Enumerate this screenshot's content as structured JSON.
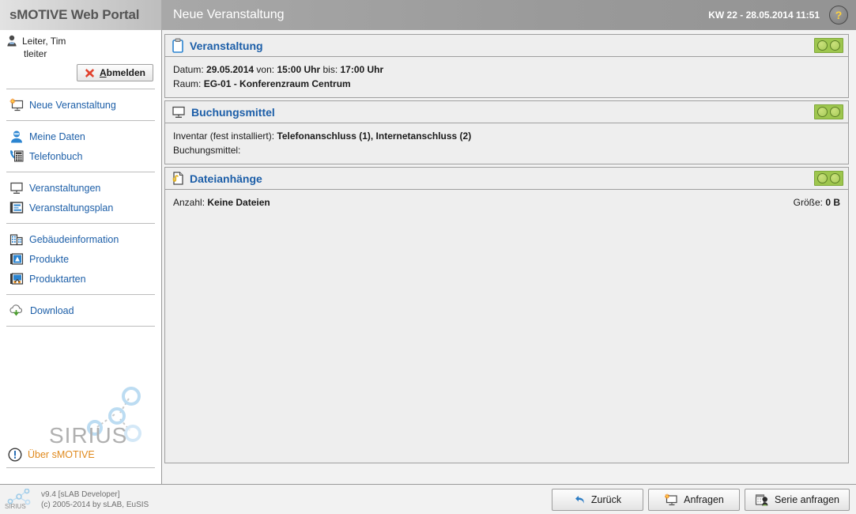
{
  "header": {
    "brand": "sMOTIVE Web Portal",
    "page_title": "Neue Veranstaltung",
    "kw_datetime": "KW 22 - 28.05.2014 11:51",
    "help_label": "?",
    "help_icon": "question-mark-icon"
  },
  "sidebar": {
    "user": {
      "name": "Leiter, Tim",
      "login": "tleiter",
      "avatar_icon": "user-icon",
      "logout_label": "Abmelden",
      "logout_label_first": "A",
      "logout_label_rest": "bmelden",
      "logout_icon": "red-x-icon"
    },
    "groups": [
      {
        "items": [
          {
            "label": "Neue Veranstaltung",
            "icon": "new-event-monitor-icon"
          }
        ]
      },
      {
        "items": [
          {
            "label": "Meine Daten",
            "icon": "person-card-icon"
          },
          {
            "label": "Telefonbuch",
            "icon": "phonebook-icon"
          }
        ]
      },
      {
        "items": [
          {
            "label": "Veranstaltungen",
            "icon": "monitor-icon"
          },
          {
            "label": "Veranstaltungsplan",
            "icon": "schedule-icon"
          }
        ]
      },
      {
        "items": [
          {
            "label": "Gebäudeinformation",
            "icon": "building-icon"
          },
          {
            "label": "Produkte",
            "icon": "product-icon"
          },
          {
            "label": "Produktarten",
            "icon": "product-types-icon"
          }
        ]
      },
      {
        "items": [
          {
            "label": "Download",
            "icon": "cloud-download-icon"
          }
        ]
      }
    ],
    "logo_text": "SIRIUS",
    "about": {
      "label": "Über sMOTIVE",
      "icon": "info-exclamation-icon",
      "color": "#e08a1e"
    }
  },
  "panels": [
    {
      "title": "Veranstaltung",
      "icon": "clipboard-icon",
      "toggle_icon": "dual-green-dot-toggle",
      "rows": [
        {
          "parts": [
            {
              "text": "Datum: ",
              "bold": false
            },
            {
              "text": "29.05.2014",
              "bold": true
            },
            {
              "text": " von: ",
              "bold": false
            },
            {
              "text": "15:00 Uhr",
              "bold": true
            },
            {
              "text": " bis: ",
              "bold": false
            },
            {
              "text": "17:00 Uhr",
              "bold": true
            }
          ]
        },
        {
          "parts": [
            {
              "text": "Raum: ",
              "bold": false
            },
            {
              "text": "EG-01 - Konferenzraum Centrum",
              "bold": true
            }
          ]
        }
      ]
    },
    {
      "title": "Buchungsmittel",
      "icon": "monitor-icon",
      "toggle_icon": "dual-green-dot-toggle",
      "rows": [
        {
          "parts": [
            {
              "text": "Inventar (fest installiert): ",
              "bold": false
            },
            {
              "text": "Telefonanschluss (1), Internetanschluss (2)",
              "bold": true
            }
          ]
        },
        {
          "parts": [
            {
              "text": "Buchungsmittel:",
              "bold": false
            }
          ]
        }
      ]
    },
    {
      "title": "Dateianhänge",
      "icon": "file-attachment-icon",
      "toggle_icon": "dual-green-dot-toggle",
      "split_row": {
        "left": [
          {
            "text": "Anzahl: ",
            "bold": false
          },
          {
            "text": "Keine Dateien",
            "bold": true
          }
        ],
        "right": [
          {
            "text": "Größe: ",
            "bold": false
          },
          {
            "text": "0 B",
            "bold": true
          }
        ]
      }
    }
  ],
  "footer": {
    "version": "v9.4 [sLAB Developer]",
    "copyright": "(c) 2005-2014 by sLAB, EuSIS",
    "logo_text": "SIRIUS",
    "buttons": [
      {
        "label": "Zurück",
        "icon": "back-arrow-icon"
      },
      {
        "label": "Anfragen",
        "icon": "request-monitor-icon"
      },
      {
        "label": "Serie anfragen",
        "icon": "series-request-icon"
      }
    ]
  }
}
